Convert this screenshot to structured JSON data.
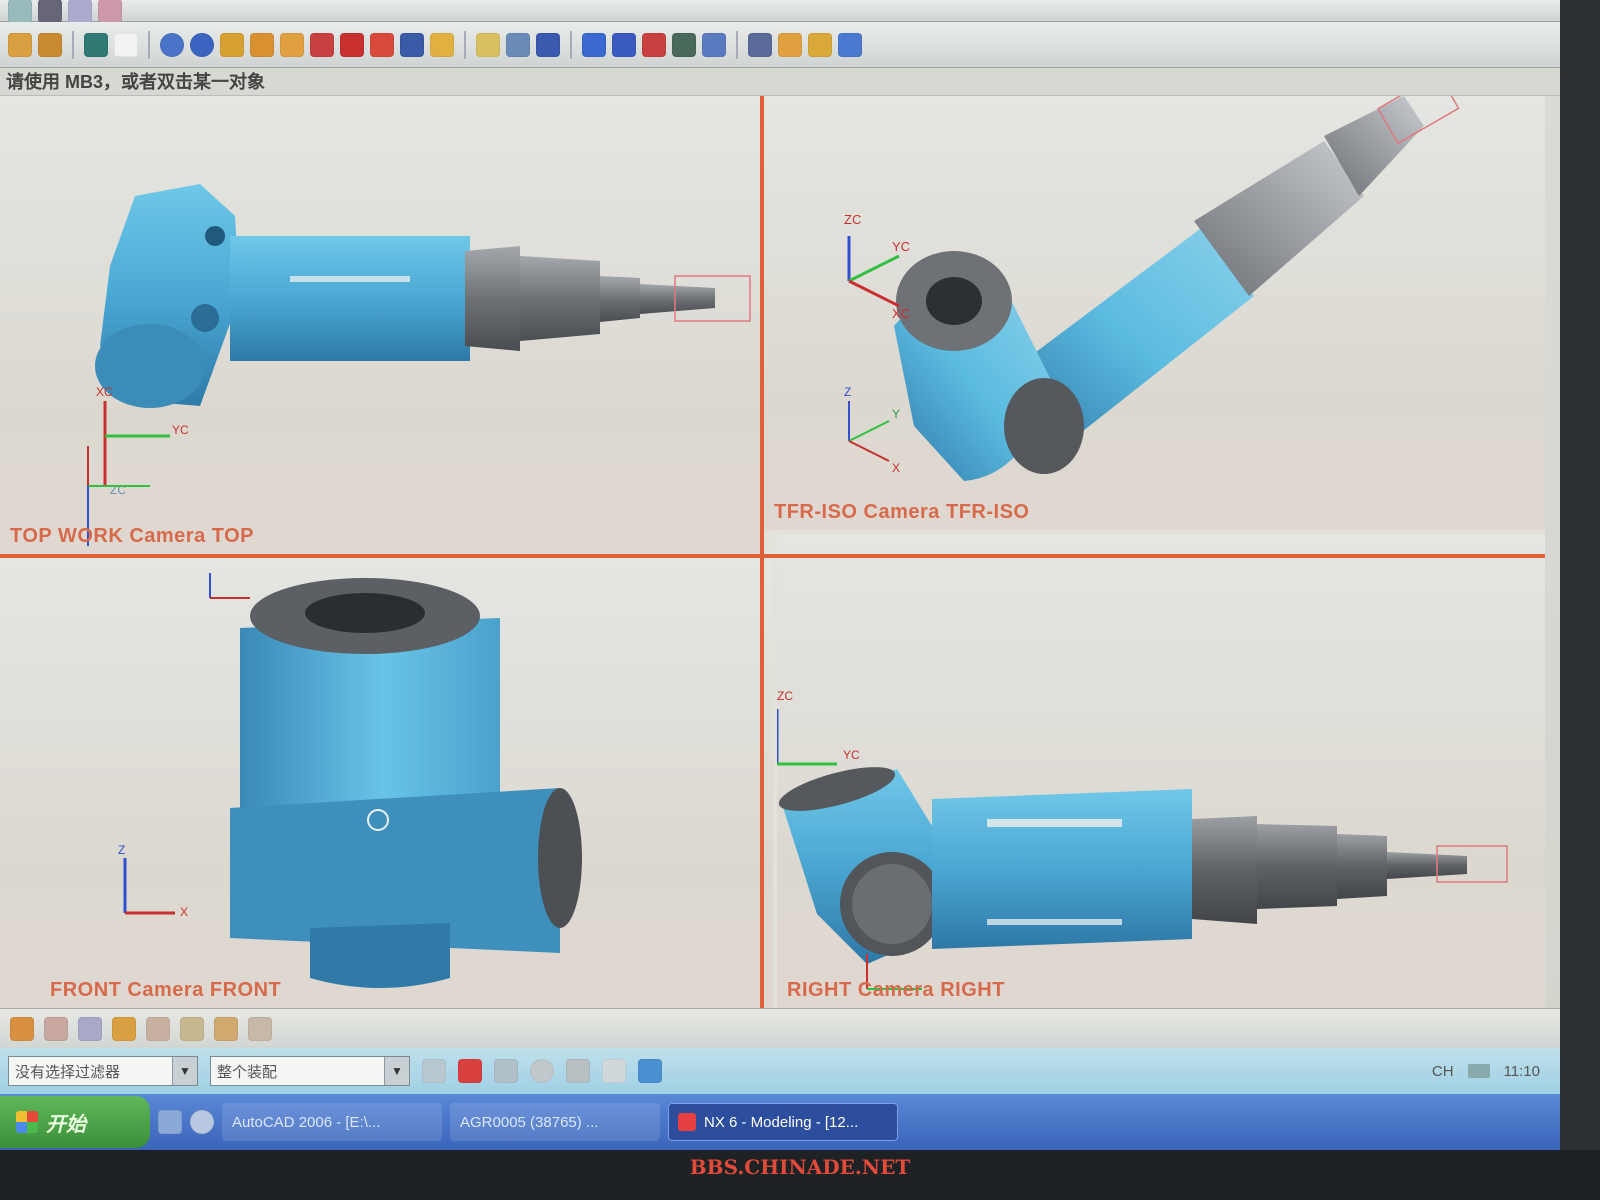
{
  "hint": {
    "text": "请使用 MB3，或者双击某一对象"
  },
  "viewports": {
    "top": {
      "label": "TOP WORK Camera TOP",
      "axes": [
        "XC",
        "YC",
        "ZC"
      ]
    },
    "iso": {
      "label": "TFR-ISO Camera TFR-ISO",
      "axes": [
        "ZC",
        "YC",
        "XC"
      ],
      "abs_axes": [
        "Z",
        "Y",
        "X"
      ]
    },
    "front": {
      "label": "FRONT Camera FRONT",
      "axes": [
        "Z",
        "X"
      ]
    },
    "right": {
      "label": "RIGHT Camera RIGHT",
      "axes": [
        "ZC",
        "YC"
      ]
    }
  },
  "filter": {
    "type_filter": "没有选择过滤器",
    "scope": "整个装配"
  },
  "tray": {
    "lang": "CH",
    "clock": "11:10"
  },
  "taskbar": {
    "start": "开始",
    "items": [
      {
        "label": "AutoCAD 2006 - [E:\\..."
      },
      {
        "label": "AGR0005 (38765) ..."
      },
      {
        "label": "NX 6 - Modeling - [12..."
      }
    ]
  },
  "watermark": "BBS.CHINADE.NET",
  "colors": {
    "part_blue": "#5ab6dc",
    "metal_gray": "#7c8084",
    "viewport_border": "#e0603a",
    "label": "#d86a4c"
  }
}
